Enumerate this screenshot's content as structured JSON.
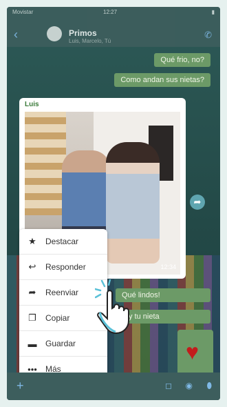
{
  "status_bar": {
    "carrier": "Movistar",
    "time": "12:27"
  },
  "chat": {
    "name": "Primos",
    "subtitle": "Luis, Marcelo, Tú"
  },
  "messages": {
    "m1": "Qué frio, no?",
    "m2": "Como andan sus nietas?",
    "sender": "Luis",
    "photo_time": "12:34",
    "m3": "Qué lindos!",
    "m4": "y tu nieta"
  },
  "context_menu": {
    "items": [
      {
        "label": "Destacar",
        "icon": "star-icon"
      },
      {
        "label": "Responder",
        "icon": "reply-icon"
      },
      {
        "label": "Reenviar",
        "icon": "forward-icon"
      },
      {
        "label": "Copiar",
        "icon": "copy-icon"
      },
      {
        "label": "Guardar",
        "icon": "folder-icon"
      },
      {
        "label": "Más",
        "icon": "more-icon"
      }
    ]
  },
  "colors": {
    "bubble": "#6c9a67",
    "accent": "#5fa5b0",
    "heart": "#c21c1c"
  }
}
